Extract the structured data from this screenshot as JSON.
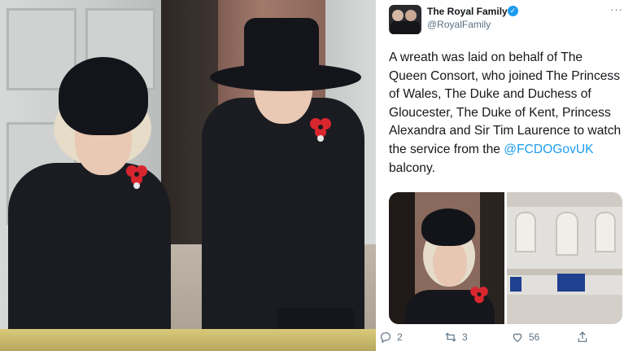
{
  "tweet": {
    "display_name": "The Royal Family",
    "handle": "@RoyalFamily",
    "more_icon": "more-dots-icon",
    "text_before_mention": "A wreath was laid on behalf of The Queen Consort, who joined The Princess of Wales, The Duke and Duchess of Gloucester, The Duke of Kent, Princess Alexandra and Sir Tim Laurence to watch the service from the ",
    "mention": "@FCDOGovUK",
    "text_after_mention": " balcony.",
    "reply_count": "2",
    "retweet_count": "3",
    "like_count": "56",
    "verified_color": "#1d9bf0",
    "link_color": "#1d9bf0"
  },
  "icons": {
    "reply": "reply-icon",
    "retweet": "retweet-icon",
    "like": "heart-icon",
    "share": "share-icon",
    "verified": "verified-badge-icon"
  }
}
